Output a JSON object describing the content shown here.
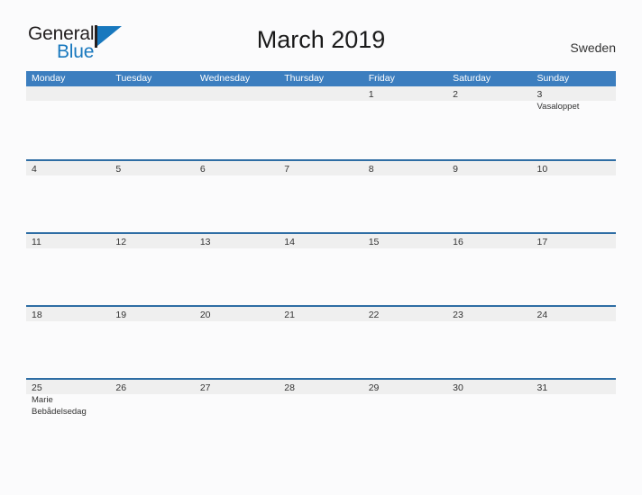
{
  "brand": {
    "name_part1": "General",
    "name_part2": "Blue",
    "logo_icon": "triangle-flag-icon"
  },
  "header": {
    "title": "March 2019",
    "region": "Sweden"
  },
  "colors": {
    "header_blue": "#3c7ebf",
    "row_border_blue": "#2e6da4",
    "band_gray": "#efefef",
    "logo_blue": "#1878be",
    "text": "#333333",
    "page_background": "#fbfbfc"
  },
  "calendar": {
    "weekday_headers": [
      "Monday",
      "Tuesday",
      "Wednesday",
      "Thursday",
      "Friday",
      "Saturday",
      "Sunday"
    ],
    "weeks": [
      {
        "days": [
          {
            "num": "",
            "events": []
          },
          {
            "num": "",
            "events": []
          },
          {
            "num": "",
            "events": []
          },
          {
            "num": "",
            "events": []
          },
          {
            "num": "1",
            "events": []
          },
          {
            "num": "2",
            "events": []
          },
          {
            "num": "3",
            "events": [
              "Vasaloppet"
            ]
          }
        ]
      },
      {
        "days": [
          {
            "num": "4",
            "events": []
          },
          {
            "num": "5",
            "events": []
          },
          {
            "num": "6",
            "events": []
          },
          {
            "num": "7",
            "events": []
          },
          {
            "num": "8",
            "events": []
          },
          {
            "num": "9",
            "events": []
          },
          {
            "num": "10",
            "events": []
          }
        ]
      },
      {
        "days": [
          {
            "num": "11",
            "events": []
          },
          {
            "num": "12",
            "events": []
          },
          {
            "num": "13",
            "events": []
          },
          {
            "num": "14",
            "events": []
          },
          {
            "num": "15",
            "events": []
          },
          {
            "num": "16",
            "events": []
          },
          {
            "num": "17",
            "events": []
          }
        ]
      },
      {
        "days": [
          {
            "num": "18",
            "events": []
          },
          {
            "num": "19",
            "events": []
          },
          {
            "num": "20",
            "events": []
          },
          {
            "num": "21",
            "events": []
          },
          {
            "num": "22",
            "events": []
          },
          {
            "num": "23",
            "events": []
          },
          {
            "num": "24",
            "events": []
          }
        ]
      },
      {
        "days": [
          {
            "num": "25",
            "events": [
              "Marie Bebådelsedag"
            ]
          },
          {
            "num": "26",
            "events": []
          },
          {
            "num": "27",
            "events": []
          },
          {
            "num": "28",
            "events": []
          },
          {
            "num": "29",
            "events": []
          },
          {
            "num": "30",
            "events": []
          },
          {
            "num": "31",
            "events": []
          }
        ]
      }
    ]
  }
}
